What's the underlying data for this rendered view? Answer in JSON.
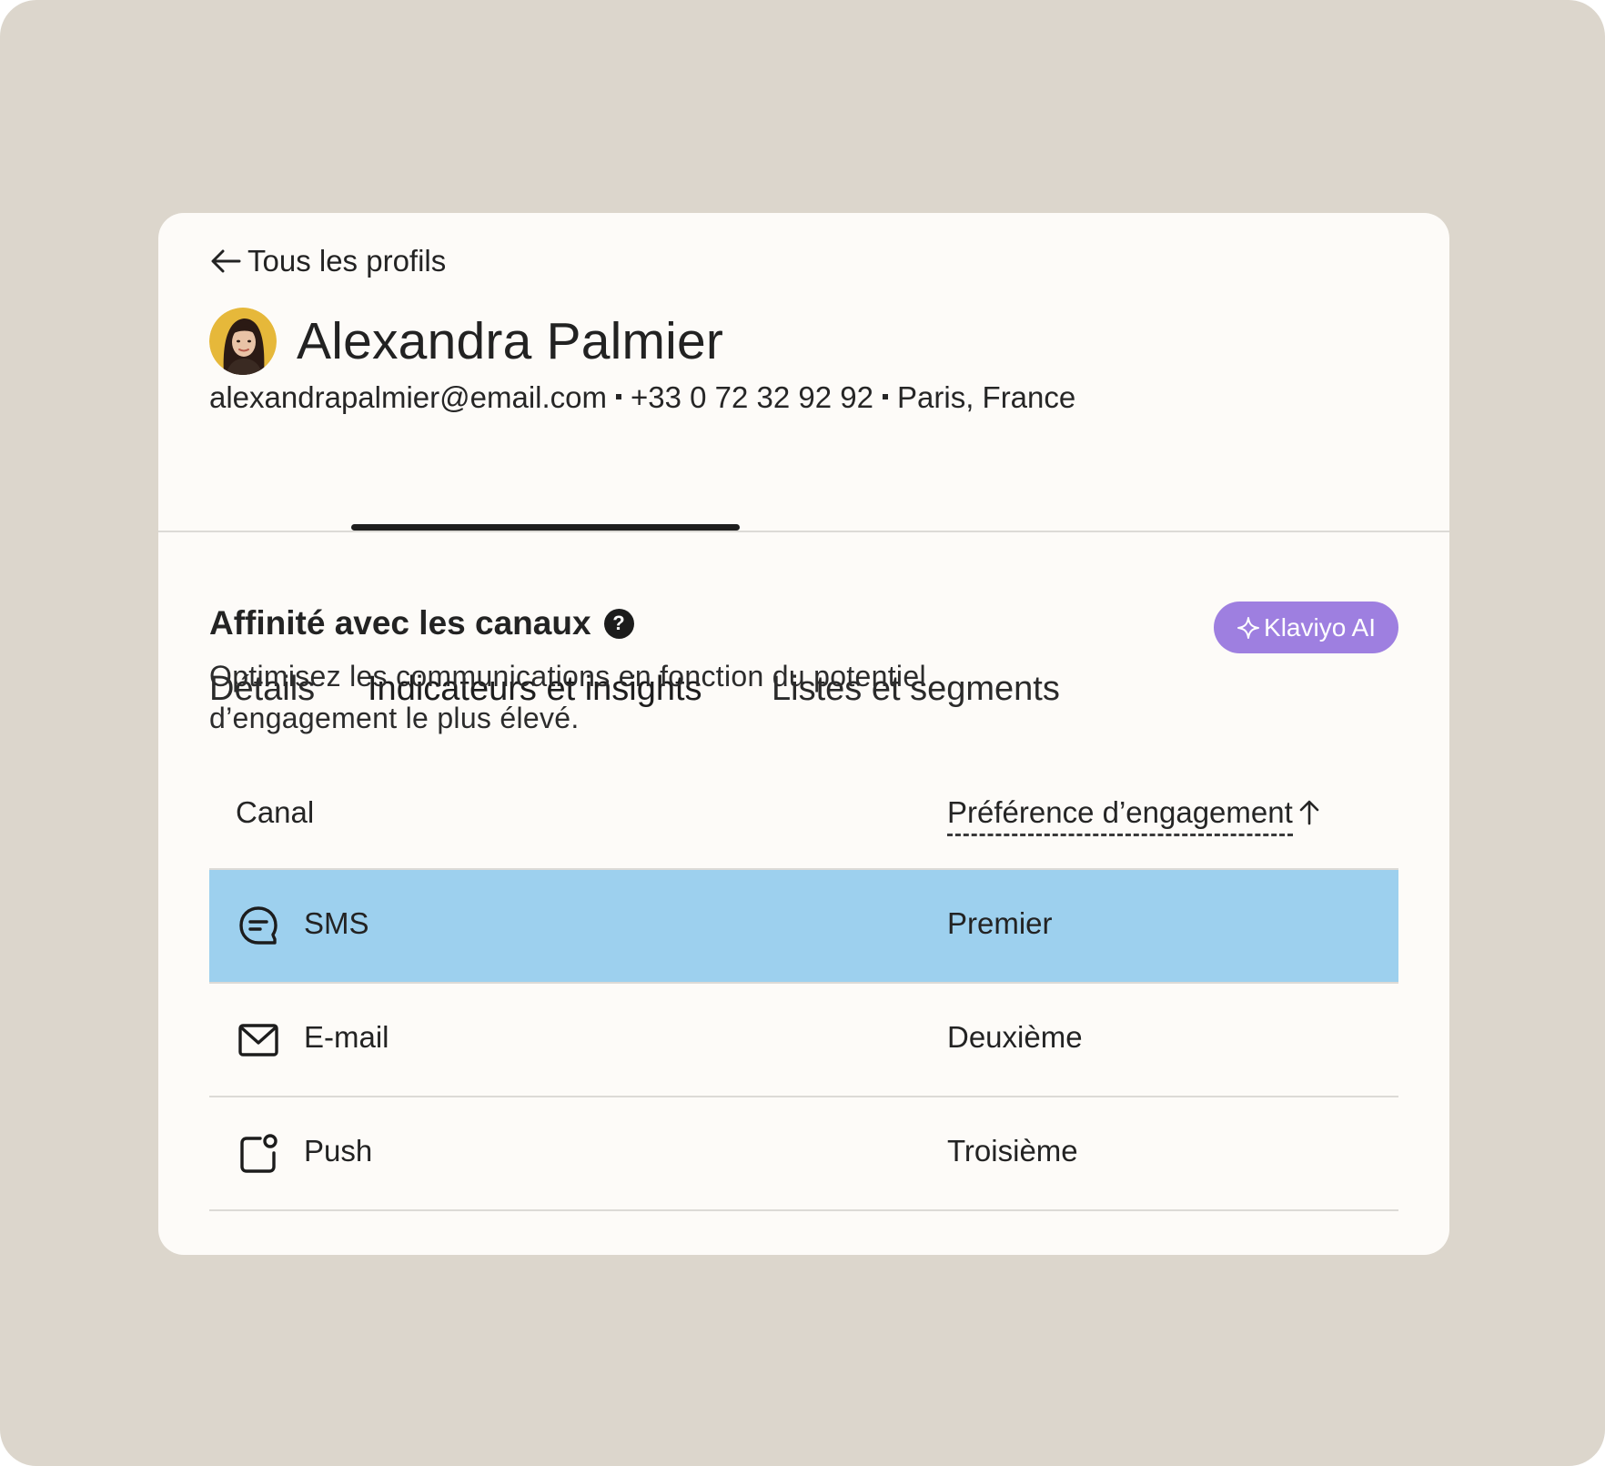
{
  "nav": {
    "back_label": "Tous les profils",
    "back_icon": "arrow-left-icon"
  },
  "profile": {
    "name": "Alexandra Palmier",
    "email": "alexandrapalmier@email.com",
    "phone": "+33 0 72 32 92 92",
    "location": "Paris, France"
  },
  "tabs": [
    {
      "label": "Détails",
      "active": false
    },
    {
      "label": "Indicateurs et insights",
      "active": true
    },
    {
      "label": "Listes et segments",
      "active": false
    }
  ],
  "section": {
    "title": "Affinité avec les canaux",
    "help_symbol": "?",
    "description": "Optimisez les communications en fonction du potentiel d’engagement le plus élevé.",
    "badge_label": "Klaviyo AI",
    "badge_icon": "sparkle-icon"
  },
  "table": {
    "columns": {
      "channel": "Canal",
      "preference": "Préférence d’engagement",
      "sort_icon": "arrow-up-icon"
    },
    "rows": [
      {
        "channel": "SMS",
        "icon": "chat-bubble-icon",
        "preference": "Premier",
        "highlighted": true
      },
      {
        "channel": "E-mail",
        "icon": "mail-icon",
        "preference": "Deuxième",
        "highlighted": false
      },
      {
        "channel": "Push",
        "icon": "push-notification-icon",
        "preference": "Troisième",
        "highlighted": false
      }
    ]
  },
  "colors": {
    "page_background": "#dcd6cc",
    "card_background": "#fdfbf8",
    "highlight_row": "#9dd0ee",
    "ai_badge": "#9e7fe0",
    "avatar_ring": "#e6b83a"
  }
}
